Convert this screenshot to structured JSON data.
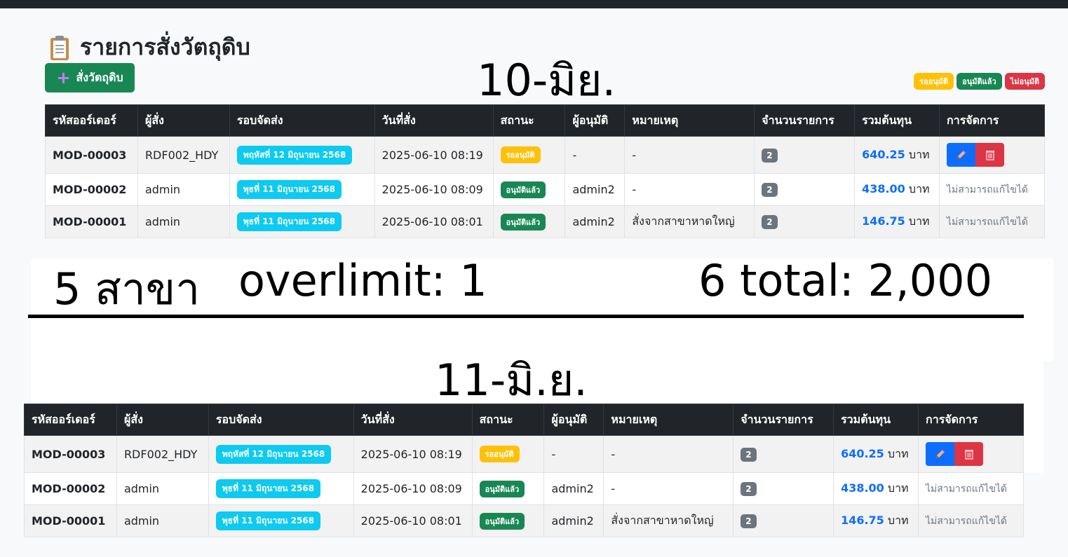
{
  "page": {
    "title": "รายการสั่งวัตถุดิบ",
    "add_button": "สั่งวัตถุดิบ"
  },
  "annotations": {
    "date_top": "10-มิย.",
    "date_bottom": "11-มิ.ย.",
    "branches": "5 สาขา",
    "overlimit": "overlimit: 1",
    "total": "6 total: 2,000"
  },
  "legend": {
    "pending": "รออนุมัติ",
    "approved": "อนุมัติแล้ว",
    "rejected": "ไม่อนุมัติ"
  },
  "colors": {
    "pending": "#ffc107",
    "approved": "#198754",
    "rejected": "#dc3545",
    "header_bg": "#212529",
    "round_badge": "#0dcaf0",
    "cost": "#0d6efd"
  },
  "table": {
    "headers": [
      "รหัสออร์เดอร์",
      "ผู้สั่ง",
      "รอบจัดส่ง",
      "วันที่สั่ง",
      "สถานะ",
      "ผู้อนุมัติ",
      "หมายเหตุ",
      "จำนวนรายการ",
      "รวมต้นทุน",
      "การจัดการ"
    ],
    "unit": "บาท",
    "rows": [
      {
        "order_no": "MOD-00003",
        "orderer": "RDF002_HDY",
        "round": "พฤหัสที่ 12 มิถุนายน 2568",
        "date": "2025-06-10 08:19",
        "status": "รออนุมัติ",
        "approver": "-",
        "note": "-",
        "items": "2",
        "cost": "640.25"
      },
      {
        "order_no": "MOD-00002",
        "orderer": "admin",
        "round": "พุธที่ 11 มิถุนายน 2568",
        "date": "2025-06-10 08:09",
        "status": "อนุมัติแล้ว",
        "approver": "admin2",
        "note": "-",
        "items": "2",
        "cost": "438.00",
        "action_text": "ไม่สามารถแก้ไขได้"
      },
      {
        "order_no": "MOD-00001",
        "orderer": "admin",
        "round": "พุธที่ 11 มิถุนายน 2568",
        "date": "2025-06-10 08:01",
        "status": "อนุมัติแล้ว",
        "approver": "admin2",
        "note": "สั่งจากสาขาหาดใหญ่",
        "items": "2",
        "cost": "146.75",
        "action_text": "ไม่สามารถแก้ไขได้"
      }
    ]
  }
}
